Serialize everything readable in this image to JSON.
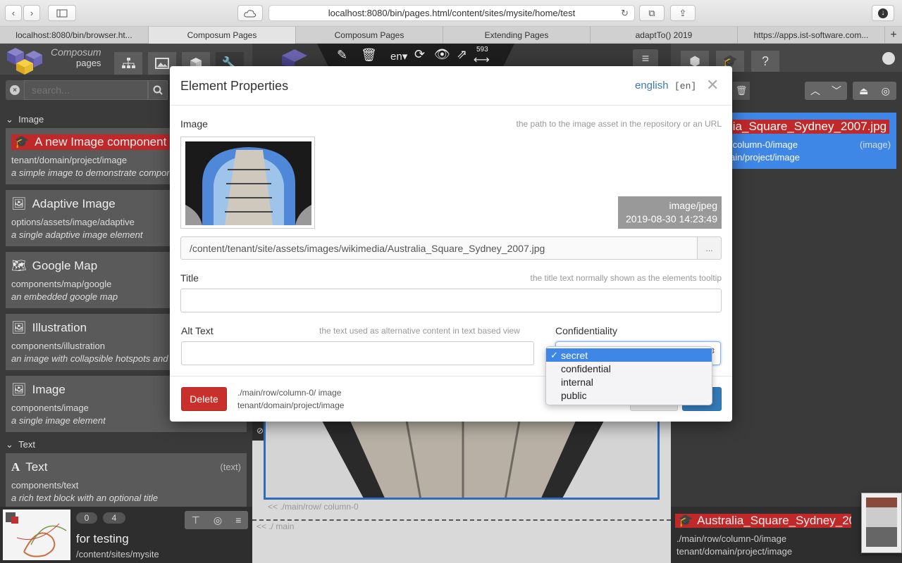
{
  "browser": {
    "url": "localhost:8080/bin/pages.html/content/sites/mysite/home/test",
    "tabs": [
      {
        "label": "localhost:8080/bin/browser.ht...",
        "active": false
      },
      {
        "label": "Composum Pages",
        "active": true
      },
      {
        "label": "Composum Pages",
        "active": false
      },
      {
        "label": "Extending Pages",
        "active": false
      },
      {
        "label": "adaptTo() 2019",
        "active": false
      },
      {
        "label": "https://apps.ist-software.com...",
        "active": false
      }
    ],
    "add_tab": "+"
  },
  "logo": {
    "line1": "Composum",
    "line2": "pages"
  },
  "search": {
    "placeholder": "search..."
  },
  "groups": [
    {
      "label": "Image"
    },
    {
      "label": "Text"
    }
  ],
  "components": [
    {
      "title": "A new Image component",
      "path": "tenant/domain/project/image",
      "desc": "a simple image to demonstrate compon"
    },
    {
      "title": "Adaptive Image",
      "path": "options/assets/image/adaptive",
      "desc": "a single adaptive image element"
    },
    {
      "title": "Google Map",
      "path": "components/map/google",
      "desc": "an embedded google map"
    },
    {
      "title": "Illustration",
      "path": "components/illustration",
      "desc": "an image with collapsible hotspots and"
    },
    {
      "title": "Image",
      "path": "components/image",
      "desc": "a single image element"
    },
    {
      "title": "Text",
      "path": "components/text",
      "desc": "a rich text block with an optional title",
      "type": "(text)"
    }
  ],
  "site": {
    "count_a": "0",
    "count_b": "4",
    "title": "for testing",
    "path": "/content/sites/mysite"
  },
  "toolbar": {
    "lang": "en",
    "width": "593"
  },
  "right_panel": {
    "selected": {
      "title": "lia_Square_Sydney_2007.jpg",
      "path": "/column-0/image",
      "type": "(image)",
      "sub": "ain/project/image"
    },
    "bottom": {
      "title": "Australia_Square_Sydney_200",
      "path": "./main/row/column-0/image",
      "sub": "tenant/domain/project/image"
    }
  },
  "center": {
    "crumb1": "<< ./main/row/ column-0",
    "crumb2": "<< ./ main"
  },
  "modal": {
    "title": "Element Properties",
    "lang": "english",
    "lang_code": "[en]",
    "image_label": "Image",
    "image_hint": "the path to the image asset in the repository or an URL",
    "mime": "image/jpeg",
    "date": "2019-08-30 14:23:49",
    "image_path": "/content/tenant/site/assets/images/wikimedia/Australia_Square_Sydney_2007.jpg",
    "browse": "...",
    "title_label": "Title",
    "title_hint": "the title text normally shown as the elements tooltip",
    "alt_label": "Alt Text",
    "alt_hint": "the text used as alternative content in text based view",
    "conf_label": "Confidentiality",
    "conf_options": [
      "secret",
      "confidential",
      "internal",
      "public"
    ],
    "conf_selected": "secret",
    "delete": "Delete",
    "footer_path": "./main/row/column-0/ image",
    "footer_type": "tenant/domain/project/image"
  }
}
